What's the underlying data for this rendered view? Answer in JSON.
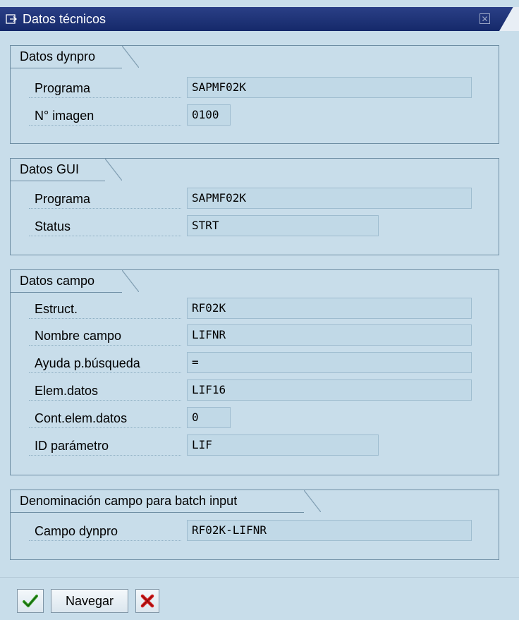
{
  "window": {
    "title": "Datos técnicos",
    "title_icon": "dialog-icon",
    "close_icon": "close-icon"
  },
  "groups": [
    {
      "title": "Datos dynpro",
      "rows": [
        {
          "label": "Programa",
          "value": "SAPMF02K"
        },
        {
          "label": "N° imagen",
          "value": "0100"
        }
      ]
    },
    {
      "title": "Datos GUI",
      "rows": [
        {
          "label": "Programa",
          "value": "SAPMF02K"
        },
        {
          "label": "Status",
          "value": "STRT"
        }
      ]
    },
    {
      "title": "Datos campo",
      "rows": [
        {
          "label": "Estruct.",
          "value": "RF02K"
        },
        {
          "label": "Nombre campo",
          "value": "LIFNR"
        },
        {
          "label": "Ayuda p.búsqueda",
          "value": "="
        },
        {
          "label": "Elem.datos",
          "value": "LIF16"
        },
        {
          "label": "Cont.elem.datos",
          "value": "0"
        },
        {
          "label": "ID parámetro",
          "value": "LIF"
        }
      ]
    },
    {
      "title": "Denominación campo para batch input",
      "rows": [
        {
          "label": "Campo dynpro",
          "value": "RF02K-LIFNR"
        }
      ]
    }
  ],
  "toolbar": {
    "continue_icon": "check-icon",
    "navigate_label": "Navegar",
    "cancel_icon": "cancel-icon"
  },
  "colors": {
    "titlebar": "#15296a",
    "background": "#c8ddea",
    "field": "#c1d9e7",
    "check": "#2e9a1e",
    "cross": "#d11a1a"
  }
}
